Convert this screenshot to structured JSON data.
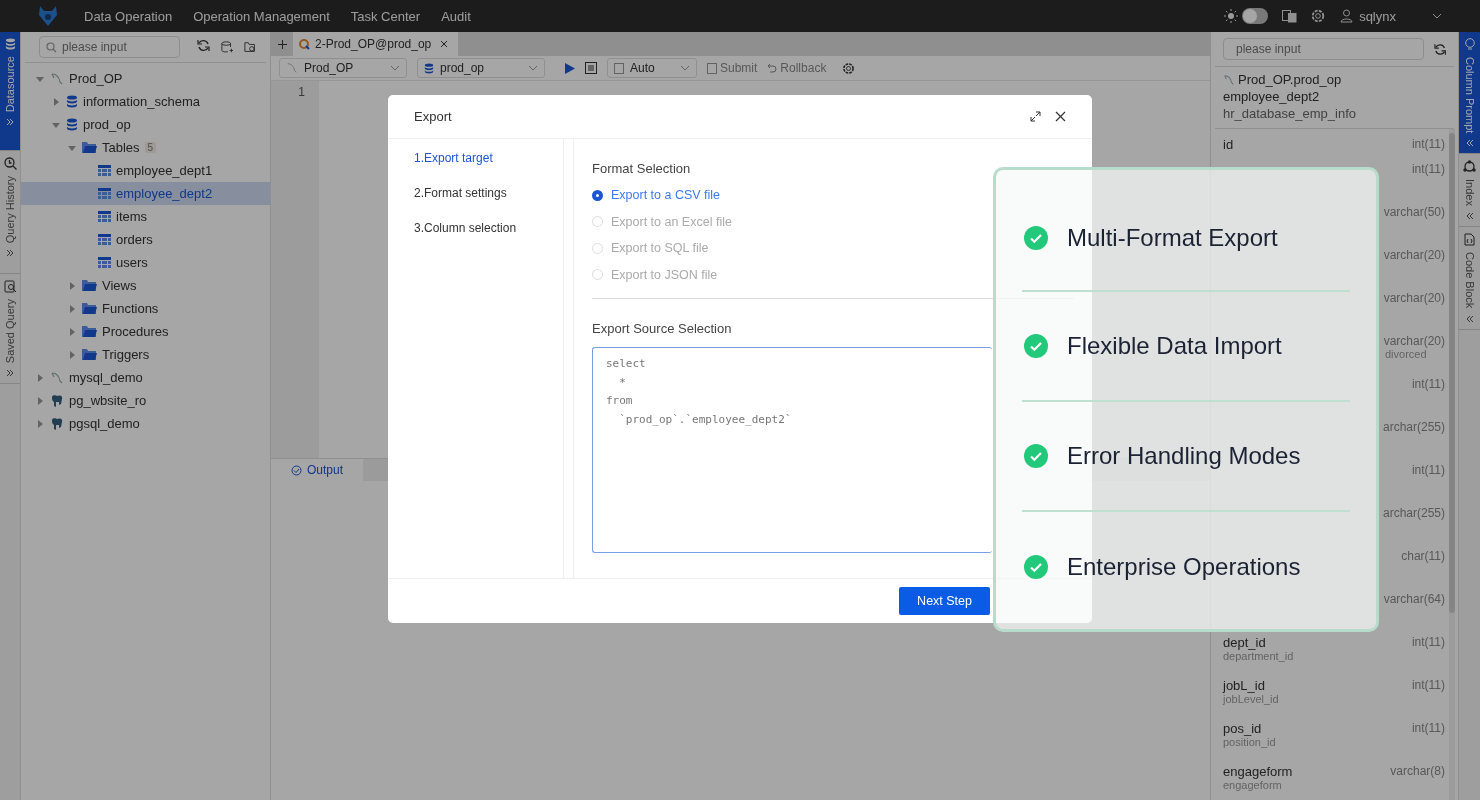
{
  "top_nav": {
    "menu": [
      "Data Operation",
      "Operation Management",
      "Task Center",
      "Audit"
    ],
    "dark_theme": false,
    "user": "sqlynx"
  },
  "left_strip": [
    {
      "label": "Datasource",
      "selected": true
    },
    {
      "label": "Query History",
      "selected": false
    },
    {
      "label": "Saved Query",
      "selected": false
    }
  ],
  "datasource": {
    "search_placeholder": "please input",
    "tree": [
      {
        "label": "Prod_OP",
        "kind": "mysql",
        "expanded": true,
        "selected": false,
        "children": [
          {
            "label": "information_schema",
            "kind": "database",
            "expanded": false,
            "selected": false
          },
          {
            "label": "prod_op",
            "kind": "database",
            "expanded": true,
            "selected": false,
            "children": [
              {
                "label": "Tables",
                "kind": "folder",
                "count": "5",
                "expanded": true,
                "selected": false,
                "children": [
                  {
                    "label": "employee_dept1",
                    "kind": "table",
                    "selected": false
                  },
                  {
                    "label": "employee_dept2",
                    "kind": "table",
                    "selected": true
                  },
                  {
                    "label": "items",
                    "kind": "table",
                    "selected": false
                  },
                  {
                    "label": "orders",
                    "kind": "table",
                    "selected": false
                  },
                  {
                    "label": "users",
                    "kind": "table",
                    "selected": false
                  }
                ]
              },
              {
                "label": "Views",
                "kind": "folder",
                "expanded": false,
                "selected": false
              },
              {
                "label": "Functions",
                "kind": "folder",
                "expanded": false,
                "selected": false
              },
              {
                "label": "Procedures",
                "kind": "folder",
                "expanded": false,
                "selected": false
              },
              {
                "label": "Triggers",
                "kind": "folder",
                "expanded": false,
                "selected": false
              }
            ]
          }
        ]
      },
      {
        "label": "mysql_demo",
        "kind": "mysql",
        "expanded": false,
        "selected": false
      },
      {
        "label": "pg_wbsite_ro",
        "kind": "postgres",
        "expanded": false,
        "selected": false
      },
      {
        "label": "pgsql_demo",
        "kind": "postgres",
        "expanded": false,
        "selected": false
      }
    ]
  },
  "editor": {
    "tabs": [
      {
        "label": "2-Prod_OP@prod_op",
        "selected": true
      }
    ],
    "datasource": "Prod_OP",
    "database": "prod_op",
    "mode": "Auto",
    "submit": "Submit",
    "rollback": "Rollback",
    "line_numbers": [
      "1"
    ],
    "output_tabs": [
      {
        "label": "Output",
        "selected": true
      }
    ]
  },
  "export_dialog": {
    "title": "Export",
    "steps": [
      {
        "label": "1.Export target",
        "selected": true
      },
      {
        "label": "2.Format settings",
        "selected": false
      },
      {
        "label": "3.Column selection",
        "selected": false
      }
    ],
    "format_heading": "Format Selection",
    "formats": [
      {
        "label": "Export to a CSV file",
        "selected": true
      },
      {
        "label": "Export to an Excel file",
        "selected": false
      },
      {
        "label": "Export to SQL file",
        "selected": false
      },
      {
        "label": "Export to JSON file",
        "selected": false
      }
    ],
    "source_heading": "Export Source Selection",
    "source_sql": "select\n  *\nfrom\n  `prod_op`.`employee_dept2`",
    "next_button": "Next Step"
  },
  "column_prompt": {
    "search_placeholder": "please input",
    "path": "Prod_OP.prod_op",
    "table": "employee_dept2",
    "table_comment": "hr_database_emp_info",
    "columns": [
      {
        "name": "id",
        "type": "int(11)"
      },
      {
        "type": "int(11)"
      },
      {
        "type": "varchar(50)"
      },
      {
        "type": "varchar(20)"
      },
      {
        "type": "varchar(20)"
      },
      {
        "type": "varchar(20)",
        "comment": "divorced"
      },
      {
        "type": "int(11)"
      },
      {
        "type": "archar(255)"
      },
      {
        "type": "int(11)"
      },
      {
        "type": "archar(255)"
      },
      {
        "type": "char(11)"
      },
      {
        "type": "varchar(64)"
      },
      {
        "name": "dept_id",
        "comment": "department_id",
        "type": "int(11)"
      },
      {
        "name": "jobL_id",
        "comment": "jobLevel_id",
        "type": "int(11)"
      },
      {
        "name": "pos_id",
        "comment": "position_id",
        "type": "int(11)"
      },
      {
        "name": "engageform",
        "comment": "engageform",
        "type": "varchar(8)"
      }
    ]
  },
  "right_strip": [
    {
      "label": "Column Prompt",
      "selected": true
    },
    {
      "label": "Index",
      "selected": false
    },
    {
      "label": "Code Block",
      "selected": false
    }
  ],
  "feature_card": {
    "items": [
      "Multi-Format Export",
      "Flexible Data Import",
      "Error Handling Modes",
      "Enterprise Operations"
    ]
  }
}
